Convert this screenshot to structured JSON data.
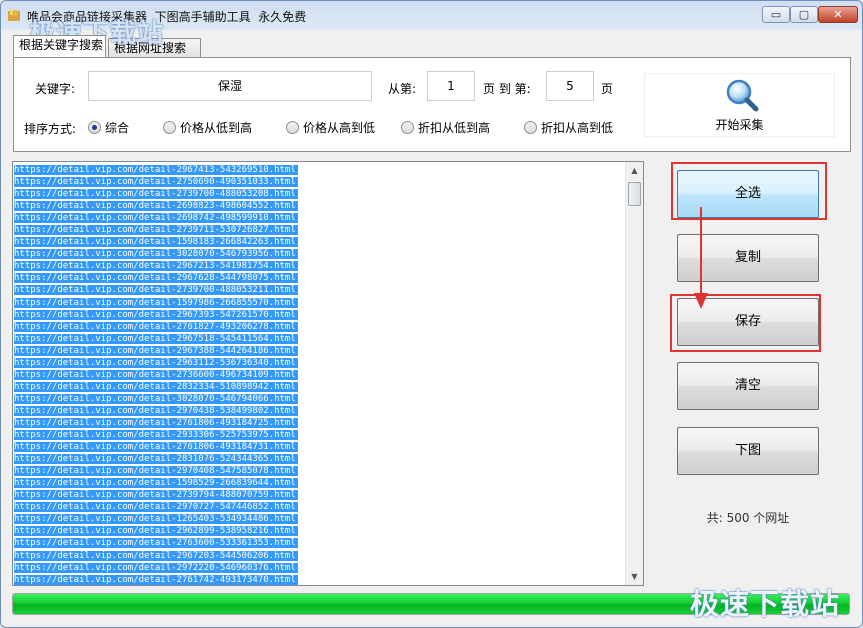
{
  "window": {
    "title": "唯品会商品链接采集器  下图高手辅助工具  永久免费",
    "watermark_top": "极速下载站",
    "watermark_bottom": "极速下载站",
    "controls": {
      "minimize": "▭",
      "maximize": "▢",
      "close": "✕"
    }
  },
  "tabs": [
    {
      "label": "根据关键字搜索",
      "active": true
    },
    {
      "label": "根据网址搜索",
      "active": false
    }
  ],
  "search": {
    "keyword_label": "关键字:",
    "keyword_value": "保湿",
    "from_label": "从第:",
    "from_value": "1",
    "page_to_label": "页 到 第:",
    "to_value": "5",
    "page_label": "页",
    "sort_label": "排序方式:",
    "sort_options": [
      {
        "label": "综合",
        "selected": true
      },
      {
        "label": "价格从低到高",
        "selected": false
      },
      {
        "label": "价格从高到低",
        "selected": false
      },
      {
        "label": "折扣从低到高",
        "selected": false
      },
      {
        "label": "折扣从高到低",
        "selected": false
      }
    ],
    "start_label": "开始采集",
    "start_icon": "magnifier-icon"
  },
  "urls": [
    "https://detail.vip.com/detail-2967413-543269510.html",
    "https://detail.vip.com/detail-2750690-490351033.html",
    "https://detail.vip.com/detail-2739700-488053208.html",
    "https://detail.vip.com/detail-2698823-498604552.html",
    "https://detail.vip.com/detail-2698742-498599910.html",
    "https://detail.vip.com/detail-2739711-530726827.html",
    "https://detail.vip.com/detail-1598183-266842263.html",
    "https://detail.vip.com/detail-3028070-546793956.html",
    "https://detail.vip.com/detail-2967213-541981754.html",
    "https://detail.vip.com/detail-2967628-544798075.html",
    "https://detail.vip.com/detail-2739700-488053211.html",
    "https://detail.vip.com/detail-1597986-266855570.html",
    "https://detail.vip.com/detail-2967393-547261570.html",
    "https://detail.vip.com/detail-2761827-493206278.html",
    "https://detail.vip.com/detail-2967518-545411564.html",
    "https://detail.vip.com/detail-2967388-544264186.html",
    "https://detail.vip.com/detail-2963112-536736340.html",
    "https://detail.vip.com/detail-2736600-496734109.html",
    "https://detail.vip.com/detail-2832334-510898942.html",
    "https://detail.vip.com/detail-3028070-546794066.html",
    "https://detail.vip.com/detail-2970438-538499802.html",
    "https://detail.vip.com/detail-2761806-493184725.html",
    "https://detail.vip.com/detail-2933306-525753975.html",
    "https://detail.vip.com/detail-2761806-493184731.html",
    "https://detail.vip.com/detail-2831076-524344365.html",
    "https://detail.vip.com/detail-2970408-547585078.html",
    "https://detail.vip.com/detail-1598529-266839644.html",
    "https://detail.vip.com/detail-2739794-488070759.html",
    "https://detail.vip.com/detail-2970727-547446852.html",
    "https://detail.vip.com/detail-1265403-534934486.html",
    "https://detail.vip.com/detail-2962899-538958216.html",
    "https://detail.vip.com/detail-2763600-533361353.html",
    "https://detail.vip.com/detail-2967203-544506206.html",
    "https://detail.vip.com/detail-2972220-546960376.html",
    "https://detail.vip.com/detail-2761742-493173470.html"
  ],
  "buttons": {
    "select_all": "全选",
    "copy": "复制",
    "save": "保存",
    "clear": "清空",
    "download": "下图"
  },
  "status": {
    "total_prefix": "共:",
    "total_count": "500",
    "total_suffix": "个网址"
  },
  "progress": {
    "fraction": 1.0,
    "color": "#12cd32"
  },
  "colors": {
    "selection": "#3399ff",
    "highlight_box": "#e03434",
    "arrow": "#e03434"
  }
}
